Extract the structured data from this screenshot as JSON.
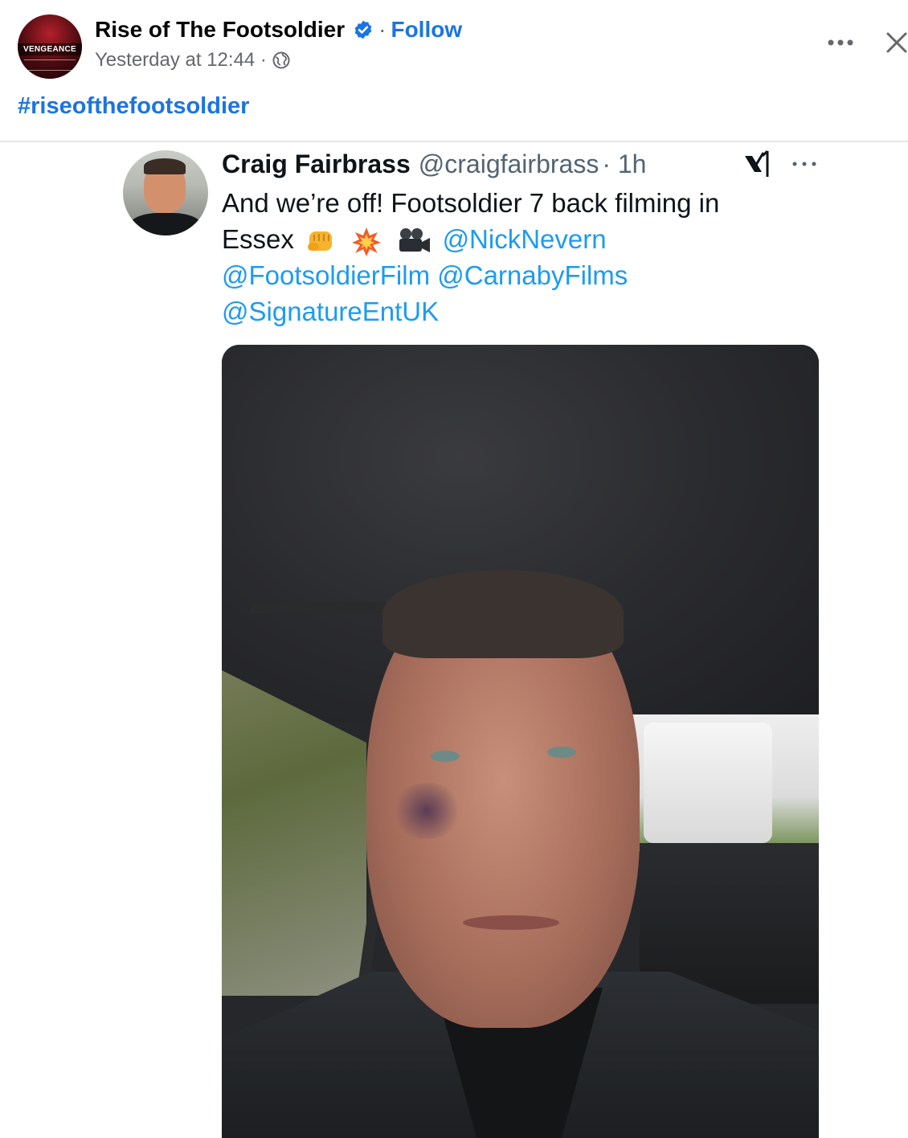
{
  "post": {
    "page_name": "Rise of The Footsoldier",
    "separator": "·",
    "follow_label": "Follow",
    "timestamp": "Yesterday at 12:44 ·",
    "avatar_brand_text": "VENGEANCE",
    "hashtag": "#riseofthefootsoldier"
  },
  "tweet": {
    "author_name": "Craig Fairbrass",
    "handle": "@craigfairbrass",
    "time": "· 1h",
    "text_line1": "And we’re off! Footsoldier 7 back filming in",
    "text_line2_prefix": "Essex",
    "emojis": [
      "oncoming-fist",
      "collision",
      "movie-camera"
    ],
    "mentions": [
      "@NickNevern",
      "@FootsoldierFilm",
      "@CarnabyFilms",
      "@SignatureEntUK"
    ]
  },
  "icons": {
    "verified": "verified-badge-icon",
    "globe": "globe-icon",
    "more": "more-options-icon",
    "close": "close-icon",
    "x_logo": "x-logo-icon"
  },
  "colors": {
    "facebook_blue": "#1b74e4",
    "twitter_blue": "#1d9bf0",
    "meta_gray": "#65676b"
  }
}
